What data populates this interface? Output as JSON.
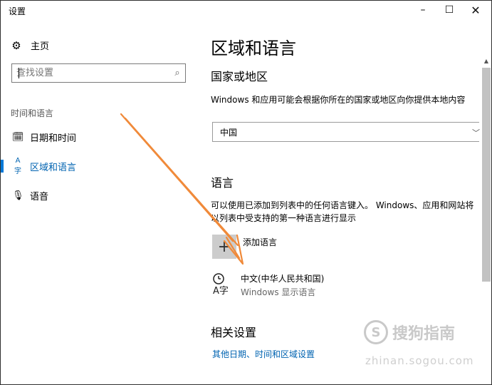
{
  "window": {
    "title": "设置",
    "minimize": "–",
    "maximize": "☐",
    "close": "✕"
  },
  "sidebar": {
    "home_icon": "⚙",
    "home_label": "主页",
    "search_placeholder": "查找设置",
    "search_icon": "⌕",
    "section_label": "时间和语言",
    "items": [
      {
        "icon": "🗓",
        "label": "日期和时间"
      },
      {
        "icon": "A字",
        "label": "区域和语言"
      },
      {
        "icon": "🎙",
        "label": "语音"
      }
    ]
  },
  "main": {
    "title": "区域和语言",
    "region": {
      "heading": "国家或地区",
      "description": "Windows 和应用可能会根据你所在的国家或地区向你提供本地内容",
      "selected": "中国"
    },
    "language": {
      "heading": "语言",
      "description": "可以使用已添加到列表中的任何语言键入。 Windows、应用和网站将以列表中受支持的第一种语言进行显示",
      "add_label": "添加语言",
      "add_icon": "+",
      "entry_name": "中文(中华人民共和国)",
      "entry_sub": "Windows 显示语言"
    },
    "related": {
      "heading": "相关设置",
      "link": "其他日期、时间和区域设置"
    }
  },
  "watermark": {
    "text": "搜狗指南",
    "logo": "S",
    "url": "zhinan.sogou.com"
  },
  "colors": {
    "accent": "#0063b1",
    "arrow": "#f08a3a"
  }
}
